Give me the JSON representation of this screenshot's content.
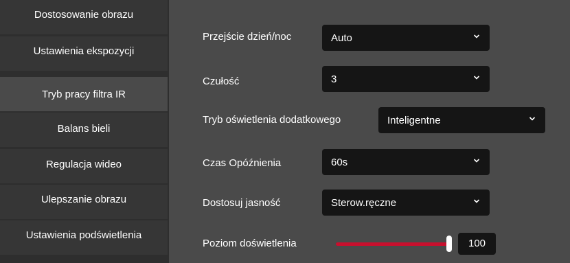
{
  "sidebar": {
    "items": [
      {
        "label": "Dostosowanie obrazu",
        "active": false
      },
      {
        "label": "Ustawienia ekspozycji",
        "active": false
      },
      {
        "label": "Tryb pracy filtra IR",
        "active": true
      },
      {
        "label": "Balans bieli",
        "active": false
      },
      {
        "label": "Regulacja wideo",
        "active": false
      },
      {
        "label": "Ulepszanie obrazu",
        "active": false
      },
      {
        "label": "Ustawienia podświetlenia",
        "active": false
      }
    ]
  },
  "settings": {
    "day_night": {
      "label": "Przejście dzień/noc",
      "value": "Auto"
    },
    "sensitivity": {
      "label": "Czułość",
      "value": "3"
    },
    "aux_light": {
      "label": "Tryb oświetlenia dodatkowego",
      "value": "Inteligentne"
    },
    "delay": {
      "label": "Czas Opóźnienia",
      "value": "60s"
    },
    "brightness": {
      "label": "Dostosuj jasność",
      "value": "Sterow.ręczne"
    },
    "light_level": {
      "label": "Poziom doświetlenia",
      "value": "100",
      "fraction": 1.0
    }
  },
  "colors": {
    "accent": "#c8102e",
    "panel_bg": "#4a4a4a",
    "sidebar_bg": "#363636",
    "input_bg": "#151515"
  }
}
